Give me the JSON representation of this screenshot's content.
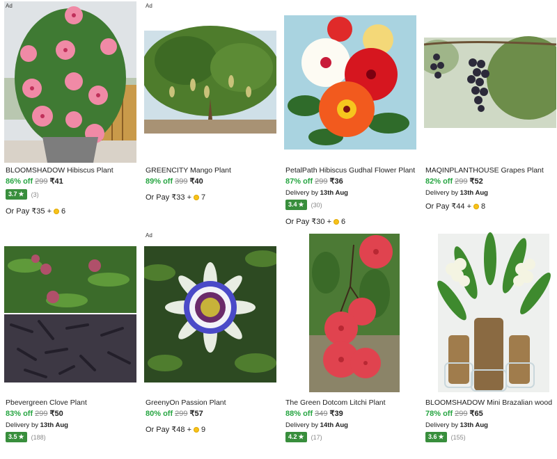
{
  "ad_label": "Ad",
  "star_glyph": "★",
  "products": [
    {
      "title": "BLOOMSHADOW Hibiscus Plant",
      "discount": "86% off",
      "mrp": "299",
      "price": "₹41",
      "delivery_prefix": "",
      "delivery_date": "",
      "rating": "3.7",
      "rating_count": "(3)",
      "pay_text": "Or Pay ₹35 +",
      "coins": "6",
      "ad": true
    },
    {
      "title": "GREENCITY Mango Plant",
      "discount": "89% off",
      "mrp": "399",
      "price": "₹40",
      "delivery_prefix": "",
      "delivery_date": "",
      "rating": "",
      "rating_count": "",
      "pay_text": "Or Pay ₹33 +",
      "coins": "7",
      "ad": true
    },
    {
      "title": "PetalPath Hibiscus Gudhal Flower Plant",
      "discount": "87% off",
      "mrp": "299",
      "price": "₹36",
      "delivery_prefix": "Delivery by",
      "delivery_date": "13th Aug",
      "rating": "3.4",
      "rating_count": "(30)",
      "pay_text": "Or Pay ₹30 +",
      "coins": "6",
      "ad": false
    },
    {
      "title": "MAQINPLANTHOUSE Grapes Plant",
      "discount": "82% off",
      "mrp": "299",
      "price": "₹52",
      "delivery_prefix": "Delivery by",
      "delivery_date": "13th Aug",
      "rating": "",
      "rating_count": "",
      "pay_text": "Or Pay ₹44 +",
      "coins": "8",
      "ad": false
    },
    {
      "title": "Pbevergreen Clove Plant",
      "discount": "83% off",
      "mrp": "299",
      "price": "₹50",
      "delivery_prefix": "Delivery by",
      "delivery_date": "13th Aug",
      "rating": "3.5",
      "rating_count": "(188)",
      "pay_text": "",
      "coins": "",
      "ad": false
    },
    {
      "title": "GreenyOn Passion Plant",
      "discount": "80% off",
      "mrp": "299",
      "price": "₹57",
      "delivery_prefix": "",
      "delivery_date": "",
      "rating": "",
      "rating_count": "",
      "pay_text": "Or Pay ₹48 +",
      "coins": "9",
      "ad": true
    },
    {
      "title": "The Green Dotcom Litchi Plant",
      "discount": "88% off",
      "mrp": "349",
      "price": "₹39",
      "delivery_prefix": "Delivery by",
      "delivery_date": "14th Aug",
      "rating": "4.2",
      "rating_count": "(17)",
      "pay_text": "",
      "coins": "",
      "ad": false
    },
    {
      "title": "BLOOMSHADOW Mini Brazalian wood",
      "discount": "78% off",
      "mrp": "299",
      "price": "₹65",
      "delivery_prefix": "Delivery by",
      "delivery_date": "13th Aug",
      "rating": "3.6",
      "rating_count": "(155)",
      "pay_text": "",
      "coins": "",
      "ad": false
    }
  ],
  "colors": {
    "discount": "#26a541",
    "rating_badge": "#388e3c",
    "coin": "#f7c21b"
  }
}
